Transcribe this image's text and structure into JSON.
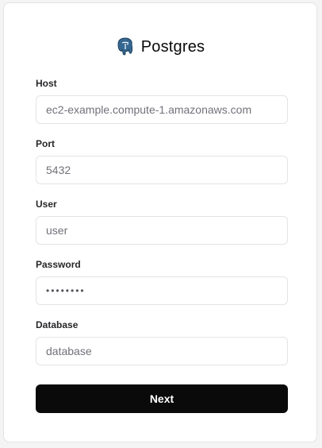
{
  "header": {
    "title": "Postgres",
    "icon": "postgres-elephant-icon"
  },
  "form": {
    "host": {
      "label": "Host",
      "placeholder": "ec2-example.compute-1.amazonaws.com",
      "value": ""
    },
    "port": {
      "label": "Port",
      "placeholder": "5432",
      "value": ""
    },
    "user": {
      "label": "User",
      "placeholder": "user",
      "value": ""
    },
    "password": {
      "label": "Password",
      "value": "••••••••"
    },
    "database": {
      "label": "Database",
      "placeholder": "database",
      "value": ""
    }
  },
  "actions": {
    "next_label": "Next"
  },
  "colors": {
    "button_bg": "#0a0a0a",
    "border": "#e4e4e7",
    "logo_blue": "#336791"
  }
}
